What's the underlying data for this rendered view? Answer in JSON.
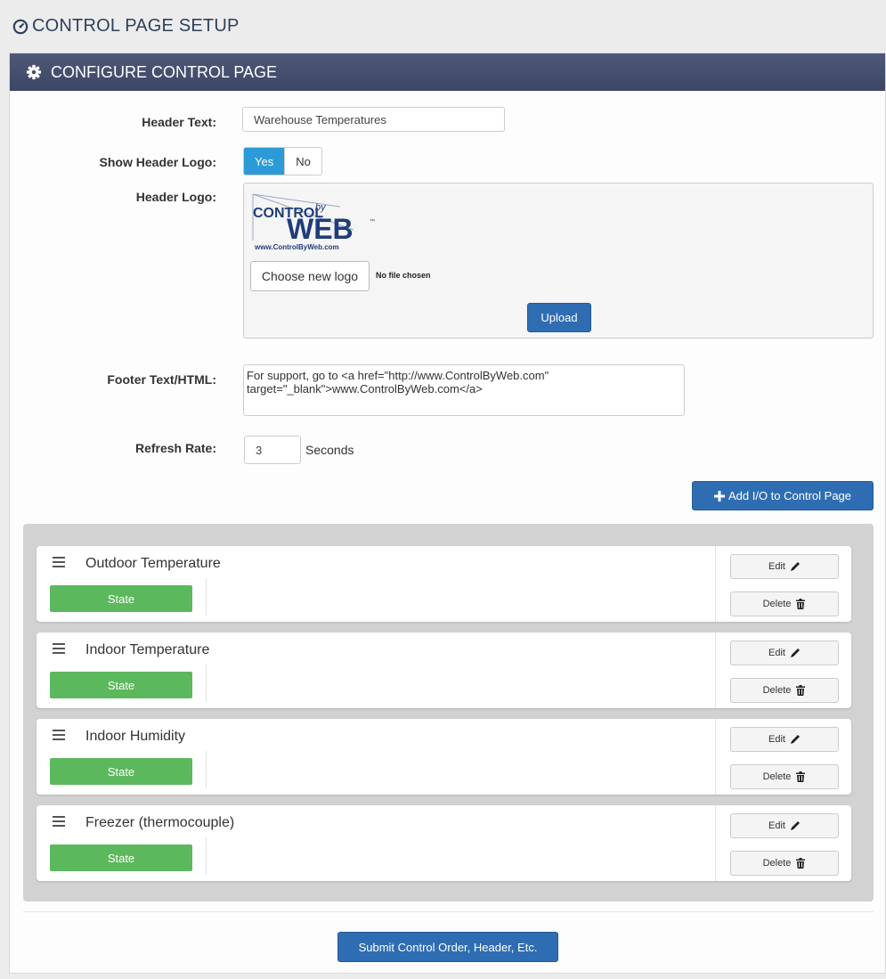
{
  "page": {
    "title": "CONTROL PAGE SETUP"
  },
  "panel": {
    "title": "CONFIGURE CONTROL PAGE"
  },
  "form": {
    "header_text_label": "Header Text:",
    "header_text_value": "Warehouse Temperatures",
    "show_logo_label": "Show Header Logo:",
    "show_logo_yes": "Yes",
    "show_logo_no": "No",
    "show_logo_selected": "Yes",
    "header_logo_label": "Header Logo:",
    "logo": {
      "top": "CONTROL",
      "by": "by",
      "web": "WEB",
      "tm": "™",
      "url": "www.ControlByWeb.com"
    },
    "choose_logo_button": "Choose new logo",
    "file_status": "No file chosen",
    "upload_button": "Upload",
    "footer_label": "Footer Text/HTML:",
    "footer_value": "For support, go to <a href=\"http://www.ControlByWeb.com\" target=\"_blank\">www.ControlByWeb.com</a>",
    "refresh_label": "Refresh Rate:",
    "refresh_value": "3",
    "refresh_unit": "Seconds"
  },
  "add_io_button": "Add I/O to Control Page",
  "io_items": [
    {
      "name": "Outdoor Temperature",
      "state": "State",
      "edit": "Edit",
      "delete": "Delete"
    },
    {
      "name": "Indoor Temperature",
      "state": "State",
      "edit": "Edit",
      "delete": "Delete"
    },
    {
      "name": "Indoor Humidity",
      "state": "State",
      "edit": "Edit",
      "delete": "Delete"
    },
    {
      "name": "Freezer (thermocouple)",
      "state": "State",
      "edit": "Edit",
      "delete": "Delete"
    }
  ],
  "submit_button": "Submit Control Order, Header, Etc.",
  "colors": {
    "primary": "#2f6db3",
    "toggle_active": "#2b9ad6",
    "state": "#5cb85c",
    "header_bar": "#4a5474"
  }
}
